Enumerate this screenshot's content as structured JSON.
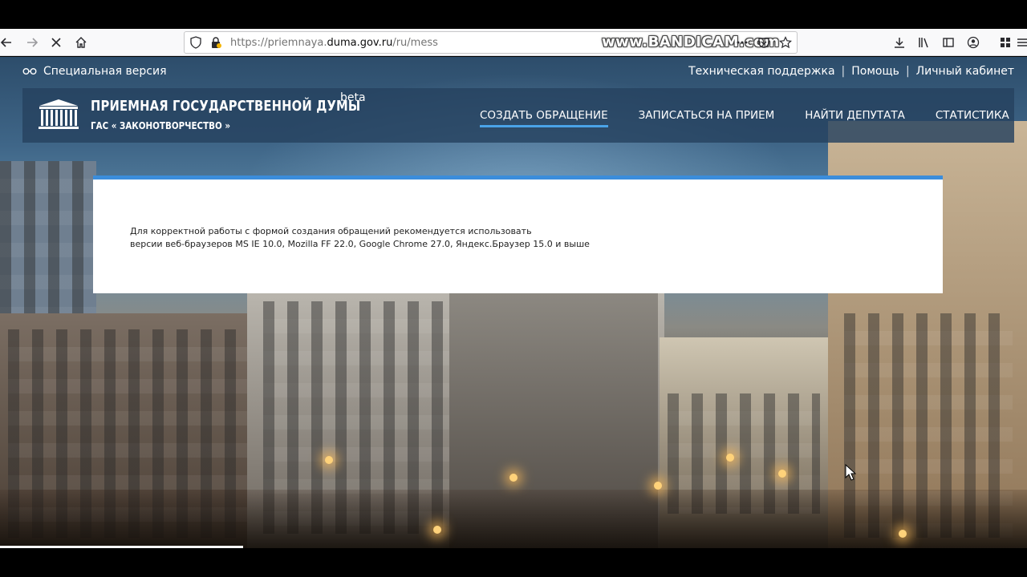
{
  "browser": {
    "url_prefix": "https://priemnaya.",
    "url_domain": "duma.gov.ru",
    "url_suffix": "/ru/mess",
    "watermark": "www.BANDICAM.com"
  },
  "page": {
    "special_version": "Специальная версия",
    "top_links": [
      "Техническая поддержка",
      "Помощь",
      "Личный кабинет"
    ],
    "header": {
      "title": "ПРИЕМНАЯ ГОСУДАРСТВЕННОЙ ДУМЫ",
      "subtitle": "ГАС « ЗАКОНОТВОРЧЕСТВО »",
      "beta": "beta"
    },
    "nav": [
      "СОЗДАТЬ ОБРАЩЕНИЕ",
      "ЗАПИСАТЬСЯ НА ПРИЕМ",
      "НАЙТИ ДЕПУТАТА",
      "СТАТИСТИКА"
    ],
    "notice_line1": "Для корректной работы с формой создания обращений рекомендуется использовать",
    "notice_line2": "версии веб-браузеров MS IE 10.0, Mozilla FF 22.0, Google Chrome 27.0, Яндекс.Браузер 15.0 и выше"
  },
  "colors": {
    "accent": "#3b8ddb",
    "header_bg": "#26425f",
    "nav_underline": "#4aa3e8"
  }
}
